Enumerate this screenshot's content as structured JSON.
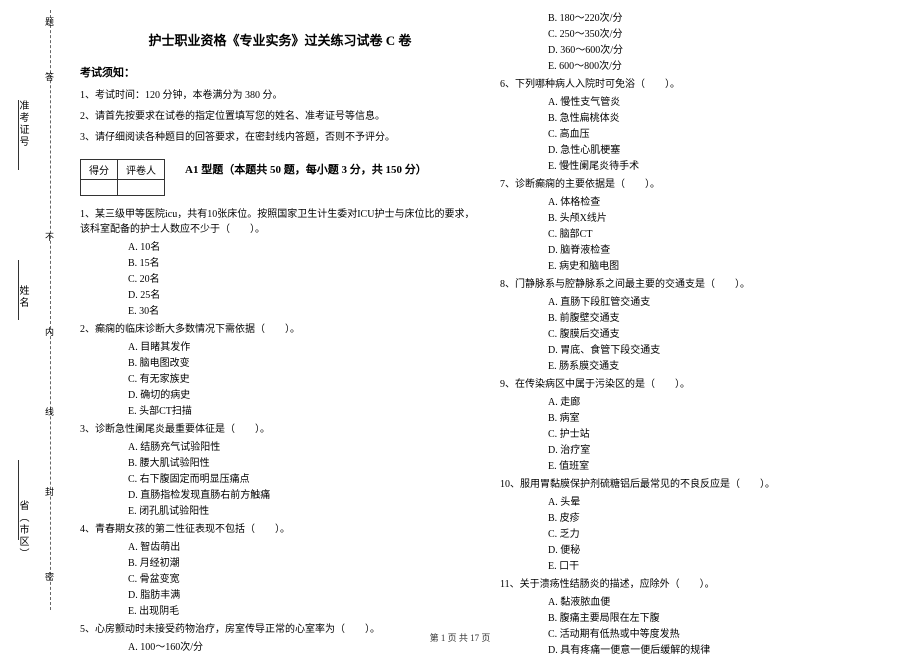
{
  "binding": {
    "labels": [
      "准考证号",
      "姓名",
      "省（市区）"
    ],
    "markers": [
      "题",
      "答",
      "不",
      "内",
      "线",
      "封",
      "密"
    ]
  },
  "title": "护士职业资格《专业实务》过关练习试卷 C 卷",
  "noticeHeading": "考试须知：",
  "instructions": [
    "1、考试时间：120 分钟，本卷满分为 380 分。",
    "2、请首先按要求在试卷的指定位置填写您的姓名、准考证号等信息。",
    "3、请仔细阅读各种题目的回答要求，在密封线内答题，否则不予评分。"
  ],
  "scoreHeaders": [
    "得分",
    "评卷人"
  ],
  "sectionTitle": "A1 型题（本题共 50 题，每小题 3 分，共 150 分）",
  "questions_left": [
    {
      "stem": "1、某三级甲等医院icu，共有10张床位。按照国家卫生计生委对ICU护士与床位比的要求，该科室配备的护士人数应不少于（　　）。",
      "opts": [
        "A. 10名",
        "B. 15名",
        "C. 20名",
        "D. 25名",
        "E. 30名"
      ]
    },
    {
      "stem": "2、癫痫的临床诊断大多数情况下需依据（　　）。",
      "opts": [
        "A. 目睹其发作",
        "B. 脑电图改变",
        "C. 有无家族史",
        "D. 确切的病史",
        "E. 头部CT扫描"
      ]
    },
    {
      "stem": "3、诊断急性阑尾炎最重要体征是（　　）。",
      "opts": [
        "A. 结肠充气试验阳性",
        "B. 腰大肌试验阳性",
        "C. 右下腹固定而明显压痛点",
        "D. 直肠指检发现直肠右前方触痛",
        "E. 闭孔肌试验阳性"
      ]
    },
    {
      "stem": "4、青春期女孩的第二性征表现不包括（　　）。",
      "opts": [
        "A. 智齿萌出",
        "B. 月经初潮",
        "C. 骨盆变宽",
        "D. 脂肪丰满",
        "E. 出现阴毛"
      ]
    },
    {
      "stem": "5、心房颤动时未接受药物治疗，房室传导正常的心室率为（　　）。",
      "opts": [
        "A. 100～160次/分"
      ]
    }
  ],
  "q5_cont": [
    "B. 180～220次/分",
    "C. 250～350次/分",
    "D. 360～600次/分",
    "E. 600～800次/分"
  ],
  "questions_right": [
    {
      "stem": "6、下列哪种病人入院时可免浴（　　）。",
      "opts": [
        "A. 慢性支气管炎",
        "B. 急性扁桃体炎",
        "C. 高血压",
        "D. 急性心肌梗塞",
        "E. 慢性阑尾炎待手术"
      ]
    },
    {
      "stem": "7、诊断癫痫的主要依据是（　　）。",
      "opts": [
        "A. 体格检查",
        "B. 头颅X线片",
        "C. 脑部CT",
        "D. 脑脊液检查",
        "E. 病史和脑电图"
      ]
    },
    {
      "stem": "8、门静脉系与腔静脉系之间最主要的交通支是（　　）。",
      "opts": [
        "A. 直肠下段肛管交通支",
        "B. 前腹壁交通支",
        "C. 腹膜后交通支",
        "D. 胃底、食管下段交通支",
        "E. 肠系膜交通支"
      ]
    },
    {
      "stem": "9、在传染病区中属于污染区的是（　　）。",
      "opts": [
        "A. 走廊",
        "B. 病室",
        "C. 护士站",
        "D. 治疗室",
        "E. 值班室"
      ]
    },
    {
      "stem": "10、服用胃黏膜保护剂硫糖铝后最常见的不良反应是（　　）。",
      "opts": [
        "A. 头晕",
        "B. 皮疹",
        "C. 乏力",
        "D. 便秘",
        "E. 口干"
      ]
    },
    {
      "stem": "11、关于溃疡性结肠炎的描述，应除外（　　）。",
      "opts": [
        "A. 黏液脓血便",
        "B. 腹痛主要局限在左下腹",
        "C. 活动期有低热或中等度发热",
        "D. 具有疼痛一便意一便后缓解的规律"
      ]
    }
  ],
  "footer": "第 1 页 共 17 页"
}
